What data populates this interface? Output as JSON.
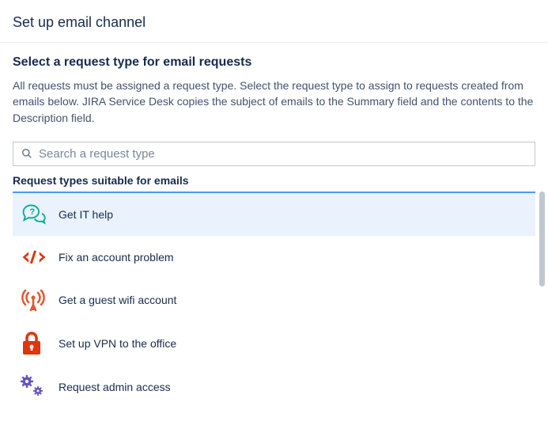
{
  "header": {
    "title": "Set up email channel"
  },
  "section": {
    "title": "Select a request type for email requests",
    "description": "All requests must be assigned a request type. Select the request type to assign to requests created from emails below. JIRA Service Desk copies the subject of emails to the Summary field and the contents to the Description field."
  },
  "search": {
    "placeholder": "Search a request type",
    "value": ""
  },
  "list": {
    "heading": "Request types suitable for emails",
    "items": [
      {
        "label": "Get IT help",
        "icon": "question-bubble-icon",
        "selected": true
      },
      {
        "label": "Fix an account problem",
        "icon": "code-icon",
        "selected": false
      },
      {
        "label": "Get a guest wifi account",
        "icon": "wifi-broadcast-icon",
        "selected": false
      },
      {
        "label": "Set up VPN to the office",
        "icon": "lock-icon",
        "selected": false
      },
      {
        "label": "Request admin access",
        "icon": "gears-icon",
        "selected": false
      }
    ]
  },
  "colors": {
    "accent": "#4c9aff",
    "teal": "#00a991",
    "red": "#de350b",
    "orange": "#e2582f",
    "purple": "#6554c0"
  }
}
